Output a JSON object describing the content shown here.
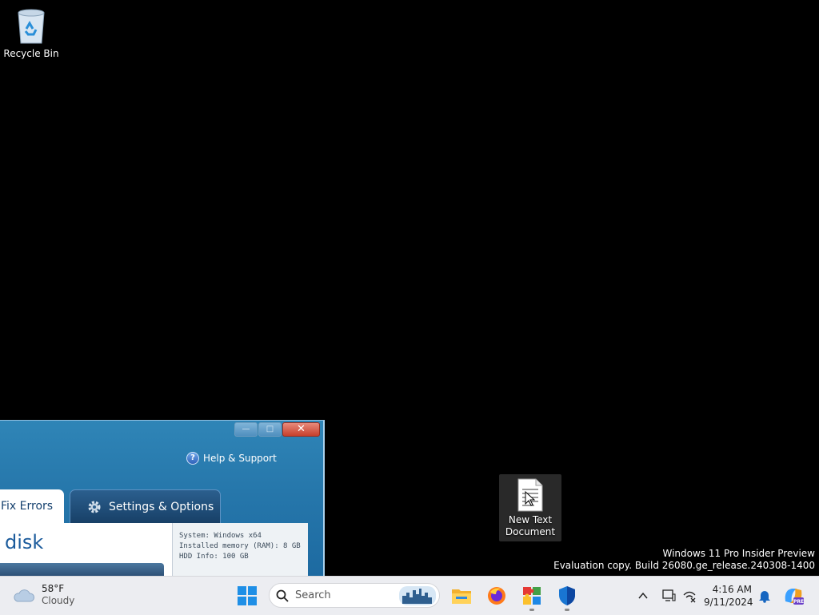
{
  "desktop": {
    "icons": [
      {
        "label": "Recycle Bin"
      },
      {
        "label": "New Text Document"
      }
    ],
    "watermark": {
      "line1": "Windows 11 Pro Insider Preview",
      "line2": "Evaluation copy. Build 26080.ge_release.240308-1400"
    }
  },
  "app_window": {
    "controls": {
      "minimize": "—",
      "maximize": "□",
      "close": "✕"
    },
    "help_label": "Help & Support",
    "tabs": [
      {
        "label": "Fix Errors",
        "active": true
      },
      {
        "label": "Settings & Options",
        "active": false
      }
    ],
    "heading": "disk",
    "system_info": {
      "system": "System: Windows x64",
      "memory": "Installed memory (RAM): 8 GB",
      "hdd": "HDD Info: 100 GB"
    }
  },
  "taskbar": {
    "weather": {
      "temp": "58°F",
      "condition": "Cloudy"
    },
    "search": {
      "placeholder": "Search"
    },
    "apps": [
      "start-icon",
      "file-explorer-icon",
      "firefox-icon",
      "puzzle-app-icon",
      "defender-icon"
    ],
    "clock": {
      "time": "4:16 AM",
      "date": "9/11/2024"
    },
    "tray": [
      "chevron-up-icon",
      "display-icon",
      "network-icon",
      "notification-bell-icon",
      "copilot-icon"
    ]
  }
}
